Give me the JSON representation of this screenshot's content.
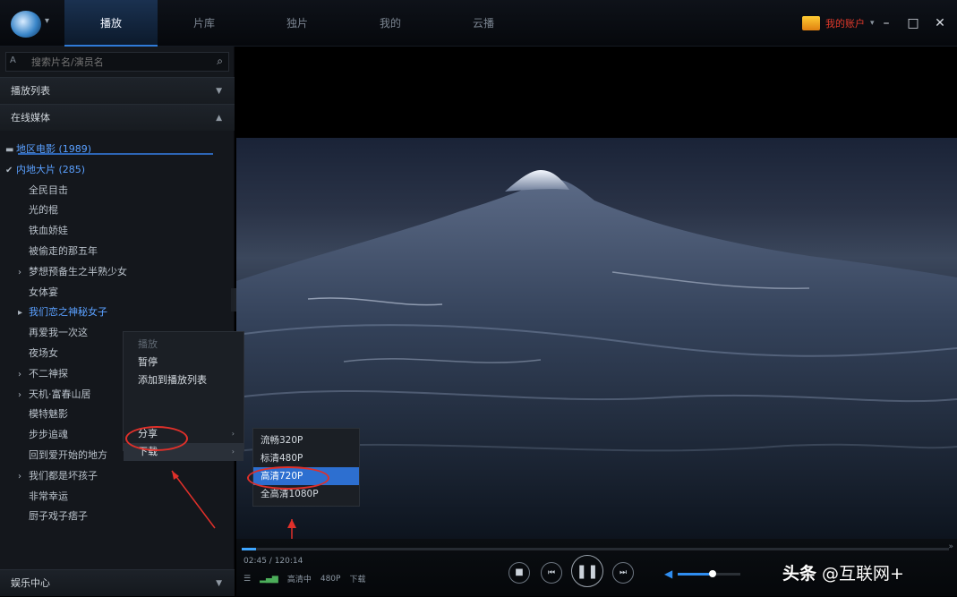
{
  "app": {
    "tabs": [
      {
        "label": "播放",
        "active": true
      },
      {
        "label": "片库",
        "active": false
      },
      {
        "label": "独片",
        "active": false
      },
      {
        "label": "我的",
        "active": false
      },
      {
        "label": "云播",
        "active": false
      }
    ],
    "user_name": "我的账户",
    "accent_color": "#2f7bd8"
  },
  "sidebar": {
    "search_prefix": "A",
    "search_placeholder": "搜索片名/演员名",
    "sections": {
      "playlist": "播放列表",
      "online": "在线媒体"
    },
    "tree": [
      {
        "prefix": "▬",
        "label": "地区电影 (1989)",
        "selected": true
      },
      {
        "prefix": "✔",
        "label": "内地大片 (285)",
        "selected": true
      },
      {
        "prefix": "",
        "label": "全民目击",
        "selected": false
      },
      {
        "prefix": "",
        "label": "光的棍",
        "selected": false
      },
      {
        "prefix": "",
        "label": "铁血娇娃",
        "selected": false
      },
      {
        "prefix": "",
        "label": "被偷走的那五年",
        "selected": false
      },
      {
        "prefix": "›",
        "label": "梦想预备生之半熟少女",
        "selected": false
      },
      {
        "prefix": "",
        "label": "女体宴",
        "selected": false
      },
      {
        "prefix": "▸",
        "label": "我们恋之神秘女子",
        "selected": true
      },
      {
        "prefix": "",
        "label": "再爱我一次这",
        "selected": false
      },
      {
        "prefix": "",
        "label": "夜场女",
        "selected": false
      },
      {
        "prefix": "›",
        "label": "不二神探",
        "selected": false
      },
      {
        "prefix": "›",
        "label": "天机·富春山居",
        "selected": false
      },
      {
        "prefix": "",
        "label": "模特魅影",
        "selected": false
      },
      {
        "prefix": "",
        "label": "步步追魂",
        "selected": false
      },
      {
        "prefix": "",
        "label": "回到爱开始的地方",
        "selected": false
      },
      {
        "prefix": "›",
        "label": "我们都是坏孩子",
        "selected": false
      },
      {
        "prefix": "",
        "label": "非常幸运",
        "selected": false
      },
      {
        "prefix": "",
        "label": "厨子戏子痞子",
        "selected": false
      }
    ],
    "bottom_section": "娱乐中心"
  },
  "context_menu": {
    "items": [
      {
        "label": "播放",
        "dim": true,
        "arrow": false
      },
      {
        "label": "暂停",
        "dim": false,
        "arrow": false
      },
      {
        "label": "添加到播放列表",
        "dim": false,
        "arrow": false
      },
      {
        "label": "",
        "dim": false,
        "arrow": false
      },
      {
        "label": "",
        "dim": false,
        "arrow": false
      },
      {
        "label": "分享",
        "dim": false,
        "arrow": true
      },
      {
        "label": "下载",
        "dim": false,
        "arrow": true
      }
    ]
  },
  "submenu": {
    "items": [
      {
        "label": "流畅320P",
        "highlight": false
      },
      {
        "label": "标清480P",
        "highlight": false
      },
      {
        "label": "高清720P",
        "highlight": true
      },
      {
        "label": "全高清1080P",
        "highlight": false
      }
    ]
  },
  "player": {
    "time": "02:45 / 120:14",
    "quality_text": "高清中",
    "resolution": "480P",
    "download_label": "下载",
    "progress": 0.02,
    "volume": 0.55
  },
  "watermark": {
    "brand": "头条",
    "handle": "@互联网+"
  }
}
